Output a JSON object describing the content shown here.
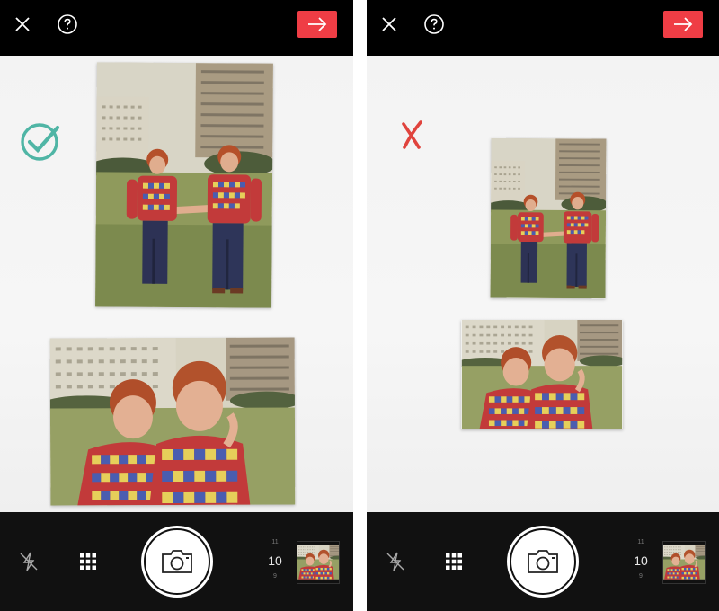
{
  "colors": {
    "accent_red": "#ef3d45",
    "check_green": "#4fb5a5",
    "cross_red": "#e0433d",
    "bar_black": "#000000",
    "bottom_bar": "#111111"
  },
  "screens": [
    {
      "id": "left",
      "topbar": {
        "close_icon": "close-icon",
        "help_icon": "help-icon",
        "next_icon": "arrow-right-icon"
      },
      "status_icon": "check-circle-icon",
      "counter": {
        "top": "11",
        "value": "10",
        "bottom": "9"
      }
    },
    {
      "id": "right",
      "topbar": {
        "close_icon": "close-icon",
        "help_icon": "help-icon",
        "next_icon": "arrow-right-icon"
      },
      "status_icon": "cross-icon",
      "counter": {
        "top": "11",
        "value": "10",
        "bottom": "9"
      }
    }
  ]
}
